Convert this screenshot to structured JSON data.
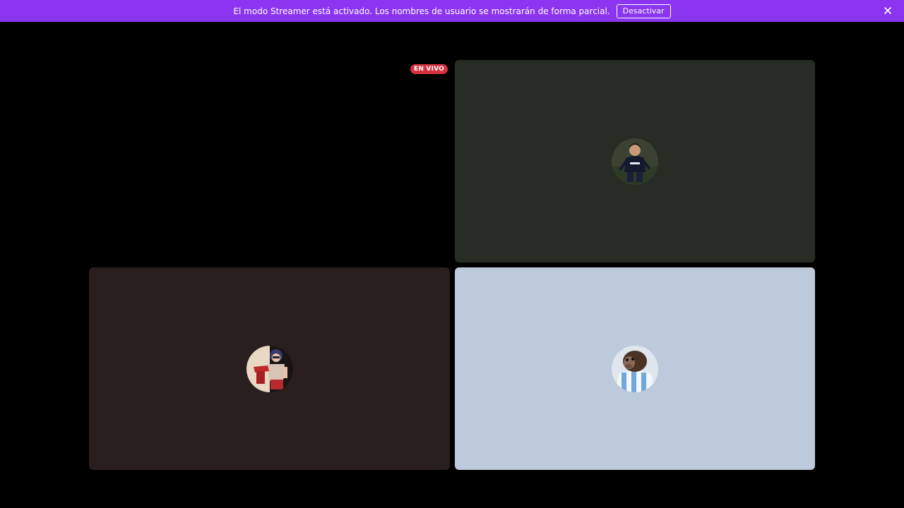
{
  "banner": {
    "message": "El modo Streamer está activado. Los nombres de usuario se mostrarán de forma parcial.",
    "deactivate_label": "Desactivar",
    "color": "#8c35f0"
  },
  "call": {
    "live_badge": "EN VIVO",
    "live_badge_color": "#d63041",
    "tiles": [
      {
        "position": "top-left",
        "background": "#000000",
        "avatar": null
      },
      {
        "position": "top-right",
        "background": "#272c24",
        "avatar": "football-player-avatar-icon"
      },
      {
        "position": "bottom-left",
        "background": "#2a1f1f",
        "avatar": "cartoon-girl-avatar-icon"
      },
      {
        "position": "bottom-right",
        "background": "#bccadb",
        "avatar": "monkey-jersey-avatar-icon"
      }
    ]
  }
}
